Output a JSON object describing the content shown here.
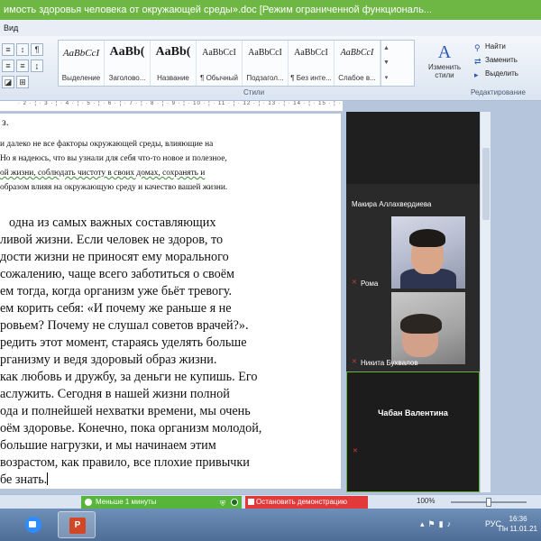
{
  "window": {
    "title": "имость здоровья человека от окружающей среды».doc [Режим ограниченной функциональ..."
  },
  "menu": {
    "tab": "Вид"
  },
  "ribbon": {
    "styles": [
      {
        "sample": "AaBbCcI",
        "name": "Выделение"
      },
      {
        "sample": "AaBb(",
        "name": "Заголово..."
      },
      {
        "sample": "AaBb(",
        "name": "Название"
      },
      {
        "sample": "AaBbCcI",
        "name": "¶ Обычный"
      },
      {
        "sample": "AaBbCcI",
        "name": "Подзагол..."
      },
      {
        "sample": "AaBbCcI",
        "name": "¶ Без инте..."
      },
      {
        "sample": "AaBbCcI",
        "name": "Слабое в..."
      }
    ],
    "styles_group_label": "Стили",
    "change_styles_label": "Изменить стили",
    "edit": {
      "find": "Найти",
      "replace": "Заменить",
      "select": "Выделить",
      "group_label": "Редактирование"
    }
  },
  "document": {
    "fragment": "з.",
    "small_lines": [
      "и далеко не все факторы окружающей среды, влияющие на",
      "Но я надеюсь, что вы узнали для себя что-то новое и полезное,",
      "ой жизни, соблюдать чистоту в своих домах, сохранять и",
      " образом влияя на окружающую среду и качество вашей жизни."
    ],
    "big_lines": [
      "одна  из  самых  важных  составляющих",
      "ливой жизни. Если человек не здоров, то",
      "дости жизни не приносят ему морального",
      " сожалению, чаще всего заботиться о своём",
      "ем тогда, когда организм уже бьёт тревогу.",
      "ем корить себя: «И почему же раньше я не",
      "ровьем? Почему не слушал советов врачей?».",
      "редить этот момент, стараясь уделять больше",
      "рганизму и ведя здоровый образ жизни.",
      "как любовь и дружбу, за деньги не купишь. Его",
      "аслужить. Сегодня в нашей жизни полной",
      "ода и полнейшей нехватки времени, мы очень",
      "оём здоровье. Конечно, пока организм молодой,",
      " большие нагрузки, и мы начинаем этим",
      " возрастом, как правило, все плохие привычки",
      "бе знать."
    ]
  },
  "video": {
    "participants": [
      {
        "name": "Макира Аллахвердиева"
      },
      {
        "name": "Рома"
      },
      {
        "name": "Никита Бухвалов"
      },
      {
        "name": "Чабан Валентина"
      }
    ]
  },
  "statusbar": {
    "share_status": "Меньше 1 минуты",
    "stop_share": "Остановить демонстрацию",
    "zoom": "100%",
    "zoom_fraction": 0.5
  },
  "taskbar": {
    "lang": "РУС",
    "time": "16:36",
    "date": "Пн 11.01.21"
  },
  "colors": {
    "titlebar": "#6fb744",
    "share_green": "#57b53a",
    "stop_red": "#e23a3a"
  }
}
